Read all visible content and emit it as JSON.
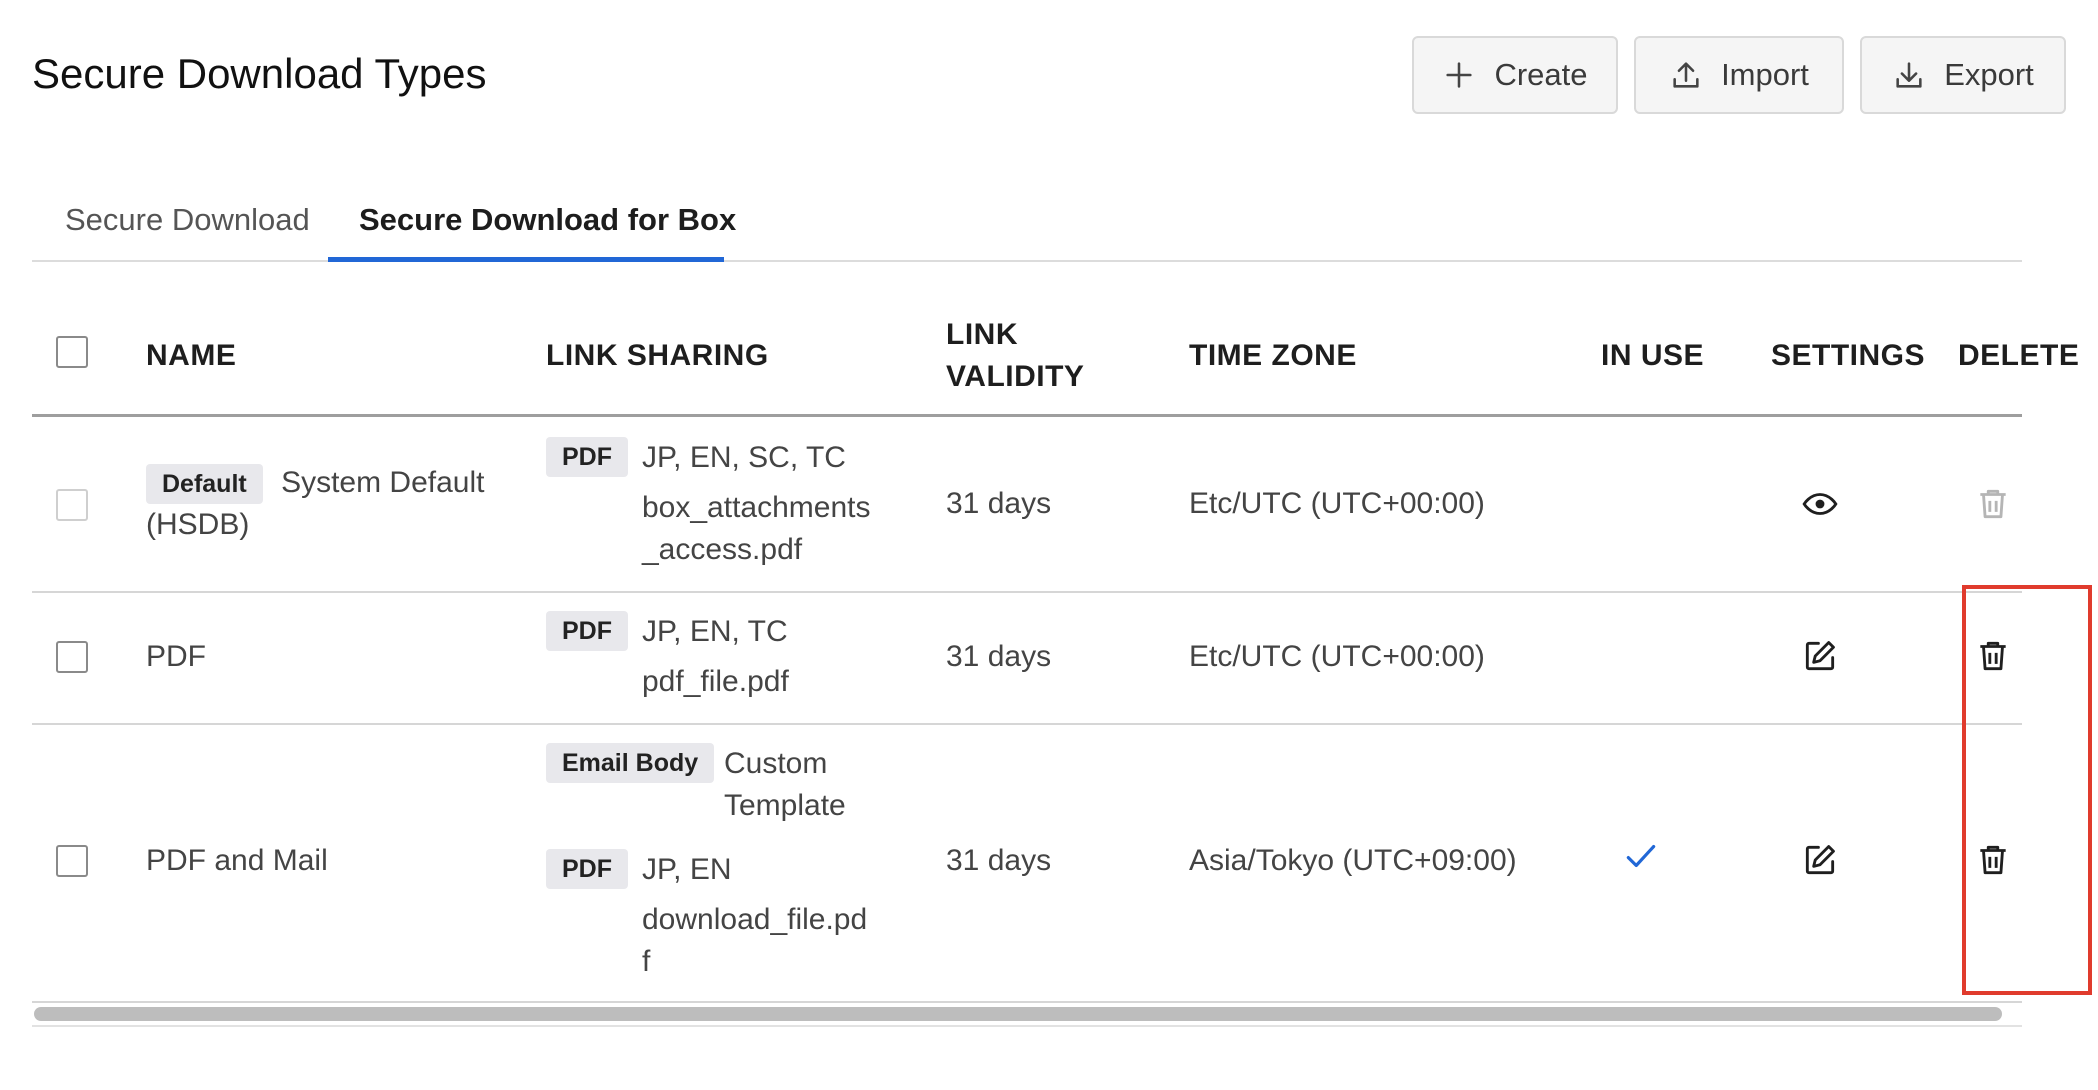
{
  "page": {
    "title": "Secure Download Types"
  },
  "toolbar": {
    "create_label": "Create",
    "import_label": "Import",
    "export_label": "Export"
  },
  "tabs": [
    {
      "label": "Secure Download",
      "active": false
    },
    {
      "label": "Secure Download for Box",
      "active": true
    }
  ],
  "table": {
    "headers": {
      "name": "NAME",
      "link_sharing": "LINK SHARING",
      "link_validity_1": "LINK",
      "link_validity_2": "VALIDITY",
      "time_zone": "TIME ZONE",
      "in_use": "IN USE",
      "settings": "SETTINGS",
      "delete": "DELETE"
    },
    "rows": [
      {
        "badge": "Default",
        "name_line1": "System Default",
        "name_line2": "(HSDB)",
        "share_tag": "PDF",
        "share_lang": "JP, EN, SC, TC",
        "share_file_1": "box_attachments",
        "share_file_2": "_access.pdf",
        "validity": "31 days",
        "timezone": "Etc/UTC (UTC+00:00)",
        "in_use": false,
        "settings_icon": "eye-icon",
        "delete_disabled": true
      },
      {
        "name": "PDF",
        "share_tag": "PDF",
        "share_lang": "JP, EN, TC",
        "share_file": "pdf_file.pdf",
        "validity": "31 days",
        "timezone": "Etc/UTC (UTC+00:00)",
        "in_use": false,
        "settings_icon": "edit-icon",
        "delete_disabled": false
      },
      {
        "name": "PDF and Mail",
        "mail_tag": "Email Body",
        "mail_value_1": "Custom",
        "mail_value_2": "Template",
        "share_tag": "PDF",
        "share_lang": "JP, EN",
        "share_file_1": "download_file.pd",
        "share_file_2": "f",
        "validity": "31 days",
        "timezone": "Asia/Tokyo (UTC+09:00)",
        "in_use": true,
        "settings_icon": "edit-icon",
        "delete_disabled": false
      }
    ]
  },
  "colors": {
    "accent": "#2167d6",
    "highlight": "#e03b2d",
    "disabled": "#b5b5b5"
  }
}
